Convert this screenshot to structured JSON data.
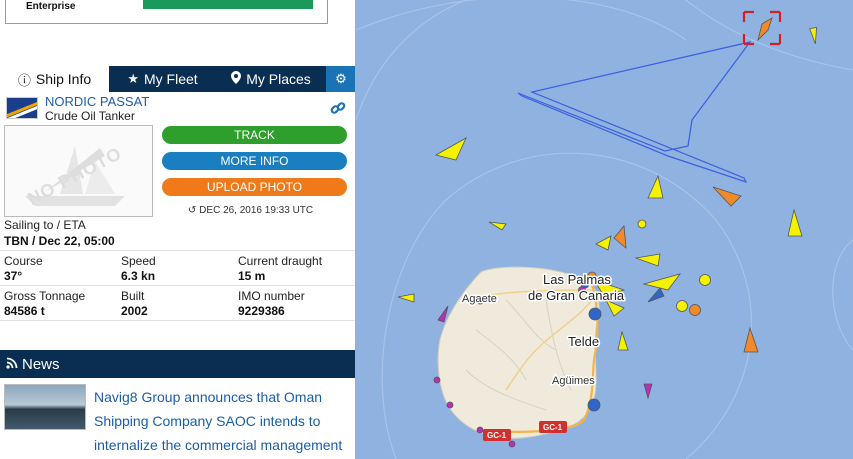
{
  "ad": {
    "label": "Enterprise"
  },
  "tabs": [
    {
      "label": "Ship Info",
      "icon": "info-icon"
    },
    {
      "label": "My Fleet",
      "icon": "star-icon"
    },
    {
      "label": "My Places",
      "icon": "map-pin-icon"
    }
  ],
  "settings_icon": "gear-icon",
  "ship": {
    "name": "NORDIC PASSAT",
    "type": "Crude Oil Tanker",
    "flag": "marshall-islands-flag",
    "photo_placeholder": "NO PHOTO"
  },
  "buttons": {
    "track": "TRACK",
    "more_info": "MORE INFO",
    "upload_photo": "UPLOAD PHOTO"
  },
  "timestamp": "DEC 26, 2016 19:33 UTC",
  "voyage": {
    "label": "Sailing to / ETA",
    "value": "TBN / Dec 22, 05:00"
  },
  "details": {
    "course_label": "Course",
    "course": "37°",
    "speed_label": "Speed",
    "speed": "6.3 kn",
    "draught_label": "Current draught",
    "draught": "15 m",
    "gross_tonnage_label": "Gross Tonnage",
    "gross_tonnage": "84586 t",
    "built_label": "Built",
    "built": "2002",
    "imo_label": "IMO number",
    "imo": "9229386"
  },
  "news": {
    "header": "News",
    "item_text": "Navig8 Group announces that Oman Shipping Company SAOC intends to internalize the commercial management"
  },
  "map": {
    "places": {
      "agaete": "Agaete",
      "las_palmas_1": "Las Palmas",
      "las_palmas_2": "de Gran Canaria",
      "telde": "Telde",
      "aguimes": "Agüimes"
    },
    "roads": {
      "gc1_a": "GC-1",
      "gc1_b": "GC-1"
    },
    "colors": {
      "sea": "#8fb2e1",
      "land": "#efeadb",
      "tanker": "#f5f200",
      "cargo": "#f08a2a",
      "passenger": "#2f66c8",
      "special": "#b830b8"
    }
  }
}
